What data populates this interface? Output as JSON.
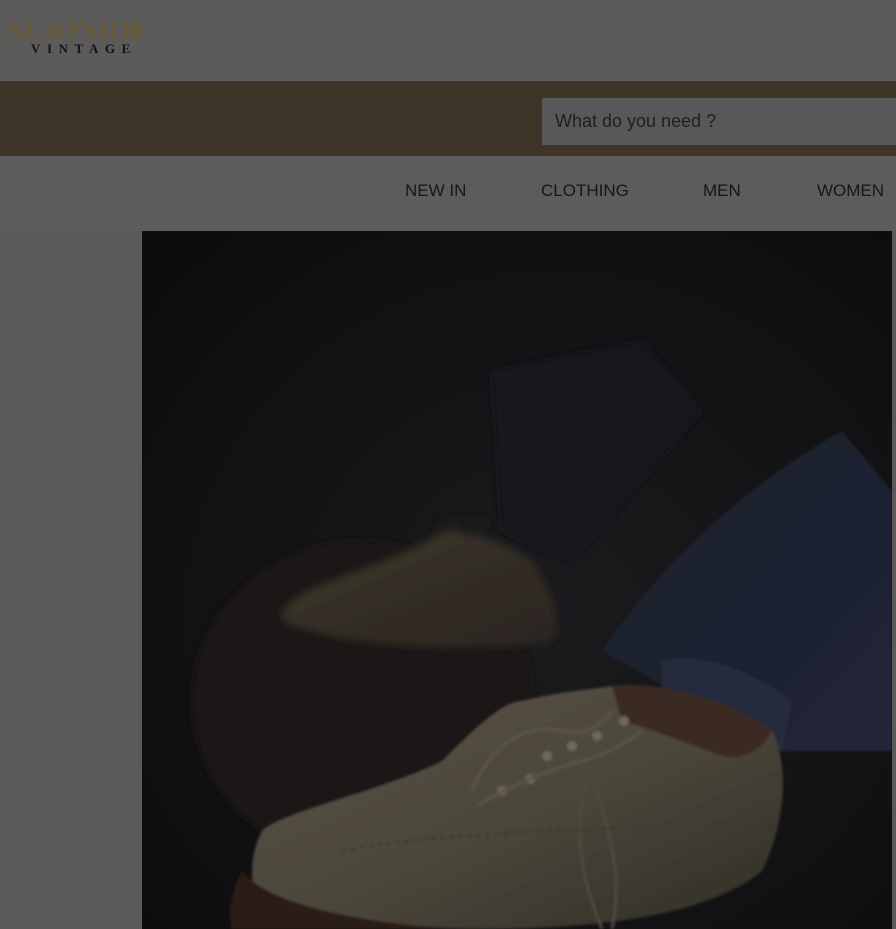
{
  "brand": {
    "logo_main": "SURFSIDE",
    "logo_sub": "VINTAGE"
  },
  "search": {
    "placeholder": "What do you need ?",
    "value": ""
  },
  "nav": {
    "items": [
      {
        "label": "NEW IN"
      },
      {
        "label": "CLOTHING"
      },
      {
        "label": "MEN"
      },
      {
        "label": "WOMEN"
      }
    ]
  },
  "hero": {
    "image_subject": "boots-photo"
  },
  "colors": {
    "header_bg": "#5b5b5b",
    "search_band": "#3e3428",
    "logo_gold": "#6f5a2c",
    "hero_bg": "#121213"
  }
}
